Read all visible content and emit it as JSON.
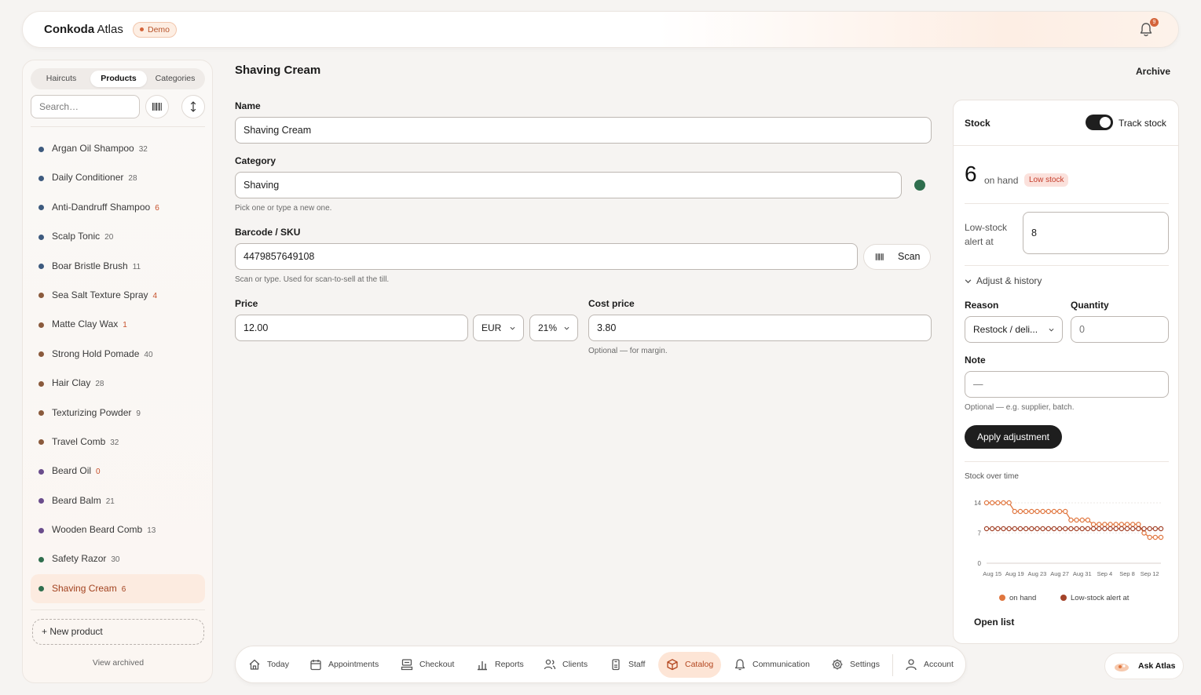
{
  "app": {
    "brand_bold": "Conkoda",
    "brand_rest": " Atlas",
    "demo_badge": "Demo",
    "notification_count": "9"
  },
  "sidebar": {
    "tabs": [
      {
        "label": "Haircuts",
        "active": false
      },
      {
        "label": "Products",
        "active": true
      },
      {
        "label": "Categories",
        "active": false
      }
    ],
    "search_placeholder": "Search…",
    "products": [
      {
        "name": "Argan Oil Shampoo",
        "count": "32",
        "color": "#3d5a7e",
        "low": false
      },
      {
        "name": "Daily Conditioner",
        "count": "28",
        "color": "#3d5a7e",
        "low": false
      },
      {
        "name": "Anti-Dandruff Shampoo",
        "count": "6",
        "color": "#3d5a7e",
        "low": true
      },
      {
        "name": "Scalp Tonic",
        "count": "20",
        "color": "#3d5a7e",
        "low": false
      },
      {
        "name": "Boar Bristle Brush",
        "count": "11",
        "color": "#3d5a7e",
        "low": false
      },
      {
        "name": "Sea Salt Texture Spray",
        "count": "4",
        "color": "#8a5a3c",
        "low": true
      },
      {
        "name": "Matte Clay Wax",
        "count": "1",
        "color": "#8a5a3c",
        "low": true
      },
      {
        "name": "Strong Hold Pomade",
        "count": "40",
        "color": "#8a5a3c",
        "low": false
      },
      {
        "name": "Hair Clay",
        "count": "28",
        "color": "#8a5a3c",
        "low": false
      },
      {
        "name": "Texturizing Powder",
        "count": "9",
        "color": "#8a5a3c",
        "low": false
      },
      {
        "name": "Travel Comb",
        "count": "32",
        "color": "#8a5a3c",
        "low": false
      },
      {
        "name": "Beard Oil",
        "count": "0",
        "color": "#6a4d8c",
        "low": true
      },
      {
        "name": "Beard Balm",
        "count": "21",
        "color": "#6a4d8c",
        "low": false
      },
      {
        "name": "Wooden Beard Comb",
        "count": "13",
        "color": "#6a4d8c",
        "low": false
      },
      {
        "name": "Safety Razor",
        "count": "30",
        "color": "#2f6e4e",
        "low": false
      },
      {
        "name": "Shaving Cream",
        "count": "6",
        "color": "#2f6e4e",
        "low": true,
        "active": true
      }
    ],
    "new_product": "+ New product",
    "view_archived": "View archived"
  },
  "main": {
    "title": "Shaving Cream",
    "archive": "Archive",
    "name_label": "Name",
    "name_value": "Shaving Cream",
    "category_label": "Category",
    "category_value": "Shaving",
    "category_color": "#2f6e4e",
    "category_hint": "Pick one or type a new one.",
    "barcode_label": "Barcode / SKU",
    "barcode_value": "4479857649108",
    "scan_label": "Scan",
    "barcode_hint": "Scan or type. Used for scan-to-sell at the till.",
    "price_label": "Price",
    "price_value": "12.00",
    "currency": "EUR",
    "vat": "21%",
    "cost_label": "Cost price",
    "cost_value": "3.80",
    "cost_hint": "Optional — for margin."
  },
  "stock": {
    "title": "Stock",
    "track_label": "Track stock",
    "track_on": true,
    "on_hand": "6",
    "on_hand_label": "on hand",
    "low_badge": "Low stock",
    "alert_label_1": "Low-stock",
    "alert_label_2": "alert at",
    "alert_value": "8",
    "adjust_label": "Adjust & history",
    "reason_label": "Reason",
    "reason_value": "Restock / deli...",
    "quantity_label": "Quantity",
    "quantity_value": "0",
    "note_label": "Note",
    "note_value": "—",
    "note_hint": "Optional — e.g. supplier, batch.",
    "apply_label": "Apply adjustment",
    "chart_title": "Stock over time",
    "open_list": "Open list"
  },
  "chart_data": {
    "type": "line",
    "title": "Stock over time",
    "x_ticks": [
      "Aug 15",
      "Aug 19",
      "Aug 23",
      "Aug 27",
      "Aug 31",
      "Sep 4",
      "Sep 8",
      "Sep 12"
    ],
    "y_ticks": [
      "14",
      "7",
      "0"
    ],
    "ylim": [
      0,
      14
    ],
    "x_domain": [
      "Aug 14",
      "Sep 14"
    ],
    "grid": true,
    "legend_position": "bottom",
    "series": [
      {
        "name": "on hand",
        "color": "#e0763f",
        "points": [
          {
            "x": "Aug 14",
            "y": 14
          },
          {
            "x": "Aug 15",
            "y": 14
          },
          {
            "x": "Aug 16",
            "y": 14
          },
          {
            "x": "Aug 17",
            "y": 14
          },
          {
            "x": "Aug 18",
            "y": 14
          },
          {
            "x": "Aug 19",
            "y": 12
          },
          {
            "x": "Aug 20",
            "y": 12
          },
          {
            "x": "Aug 21",
            "y": 12
          },
          {
            "x": "Aug 22",
            "y": 12
          },
          {
            "x": "Aug 23",
            "y": 12
          },
          {
            "x": "Aug 24",
            "y": 12
          },
          {
            "x": "Aug 25",
            "y": 12
          },
          {
            "x": "Aug 26",
            "y": 12
          },
          {
            "x": "Aug 27",
            "y": 12
          },
          {
            "x": "Aug 28",
            "y": 12
          },
          {
            "x": "Aug 29",
            "y": 10
          },
          {
            "x": "Aug 30",
            "y": 10
          },
          {
            "x": "Aug 31",
            "y": 10
          },
          {
            "x": "Sep 1",
            "y": 10
          },
          {
            "x": "Sep 2",
            "y": 9
          },
          {
            "x": "Sep 3",
            "y": 9
          },
          {
            "x": "Sep 4",
            "y": 9
          },
          {
            "x": "Sep 5",
            "y": 9
          },
          {
            "x": "Sep 6",
            "y": 9
          },
          {
            "x": "Sep 7",
            "y": 9
          },
          {
            "x": "Sep 8",
            "y": 9
          },
          {
            "x": "Sep 9",
            "y": 9
          },
          {
            "x": "Sep 10",
            "y": 9
          },
          {
            "x": "Sep 11",
            "y": 7
          },
          {
            "x": "Sep 12",
            "y": 6
          },
          {
            "x": "Sep 13",
            "y": 6
          },
          {
            "x": "Sep 14",
            "y": 6
          }
        ]
      },
      {
        "name": "Low-stock alert at",
        "color": "#a3432a",
        "points": [
          {
            "x": "Aug 14",
            "y": 8
          },
          {
            "x": "Aug 15",
            "y": 8
          },
          {
            "x": "Aug 16",
            "y": 8
          },
          {
            "x": "Aug 17",
            "y": 8
          },
          {
            "x": "Aug 18",
            "y": 8
          },
          {
            "x": "Aug 19",
            "y": 8
          },
          {
            "x": "Aug 20",
            "y": 8
          },
          {
            "x": "Aug 21",
            "y": 8
          },
          {
            "x": "Aug 22",
            "y": 8
          },
          {
            "x": "Aug 23",
            "y": 8
          },
          {
            "x": "Aug 24",
            "y": 8
          },
          {
            "x": "Aug 25",
            "y": 8
          },
          {
            "x": "Aug 26",
            "y": 8
          },
          {
            "x": "Aug 27",
            "y": 8
          },
          {
            "x": "Aug 28",
            "y": 8
          },
          {
            "x": "Aug 29",
            "y": 8
          },
          {
            "x": "Aug 30",
            "y": 8
          },
          {
            "x": "Aug 31",
            "y": 8
          },
          {
            "x": "Sep 1",
            "y": 8
          },
          {
            "x": "Sep 2",
            "y": 8
          },
          {
            "x": "Sep 3",
            "y": 8
          },
          {
            "x": "Sep 4",
            "y": 8
          },
          {
            "x": "Sep 5",
            "y": 8
          },
          {
            "x": "Sep 6",
            "y": 8
          },
          {
            "x": "Sep 7",
            "y": 8
          },
          {
            "x": "Sep 8",
            "y": 8
          },
          {
            "x": "Sep 9",
            "y": 8
          },
          {
            "x": "Sep 10",
            "y": 8
          },
          {
            "x": "Sep 11",
            "y": 8
          },
          {
            "x": "Sep 12",
            "y": 8
          },
          {
            "x": "Sep 13",
            "y": 8
          },
          {
            "x": "Sep 14",
            "y": 8
          }
        ]
      }
    ]
  },
  "dock": {
    "items": [
      {
        "label": "Today",
        "icon": "home-icon",
        "active": false
      },
      {
        "label": "Appointments",
        "icon": "calendar-icon",
        "active": false
      },
      {
        "label": "Checkout",
        "icon": "register-icon",
        "active": false
      },
      {
        "label": "Reports",
        "icon": "bar-chart-icon",
        "active": false
      },
      {
        "label": "Clients",
        "icon": "users-icon",
        "active": false
      },
      {
        "label": "Staff",
        "icon": "badge-icon",
        "active": false
      },
      {
        "label": "Catalog",
        "icon": "box-icon",
        "active": true
      },
      {
        "label": "Communication",
        "icon": "bell-icon",
        "active": false
      },
      {
        "label": "Settings",
        "icon": "gear-icon",
        "active": false
      },
      {
        "label": "Account",
        "icon": "user-icon",
        "active": false
      }
    ]
  },
  "assistant": {
    "label": "Ask Atlas"
  },
  "colors": {
    "accent": "#d4643a",
    "dark": "#1e1e1e",
    "active_bg": "#fcebe0"
  }
}
